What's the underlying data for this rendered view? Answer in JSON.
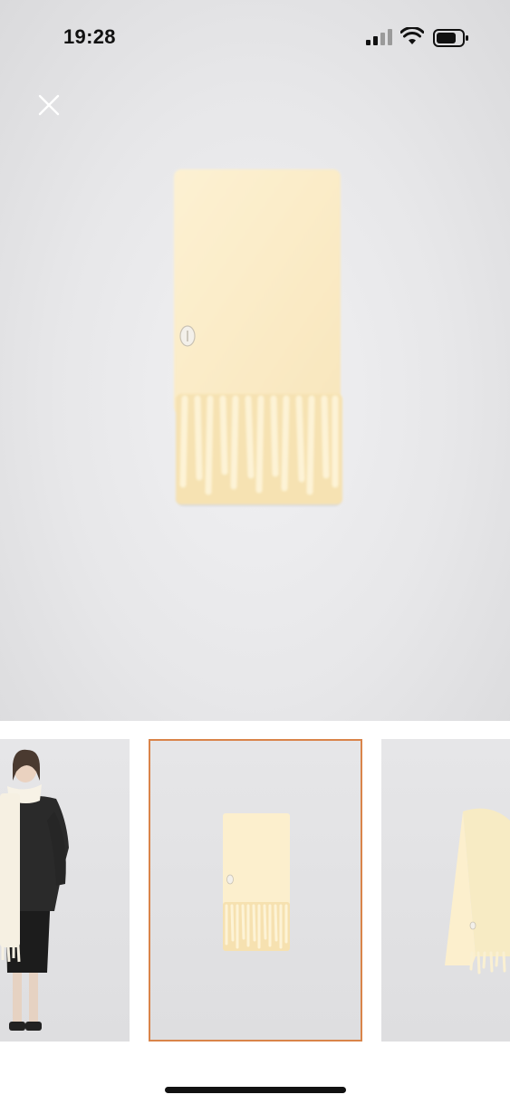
{
  "status_bar": {
    "time": "19:28",
    "icons": [
      "signal-icon",
      "wifi-icon",
      "battery-icon"
    ]
  },
  "viewer": {
    "close_icon": "close-icon",
    "main_image": "cream-fringed-scarf-folded",
    "background_color": "#e8e8ea",
    "product_color": "#fbeecb"
  },
  "thumbnails": {
    "items": [
      {
        "image": "model-wearing-cream-scarf",
        "selected": false
      },
      {
        "image": "cream-fringed-scarf-folded",
        "selected": true
      },
      {
        "image": "cream-scarf-draped-side",
        "selected": false
      }
    ],
    "selected_border_color": "#d9844a"
  }
}
